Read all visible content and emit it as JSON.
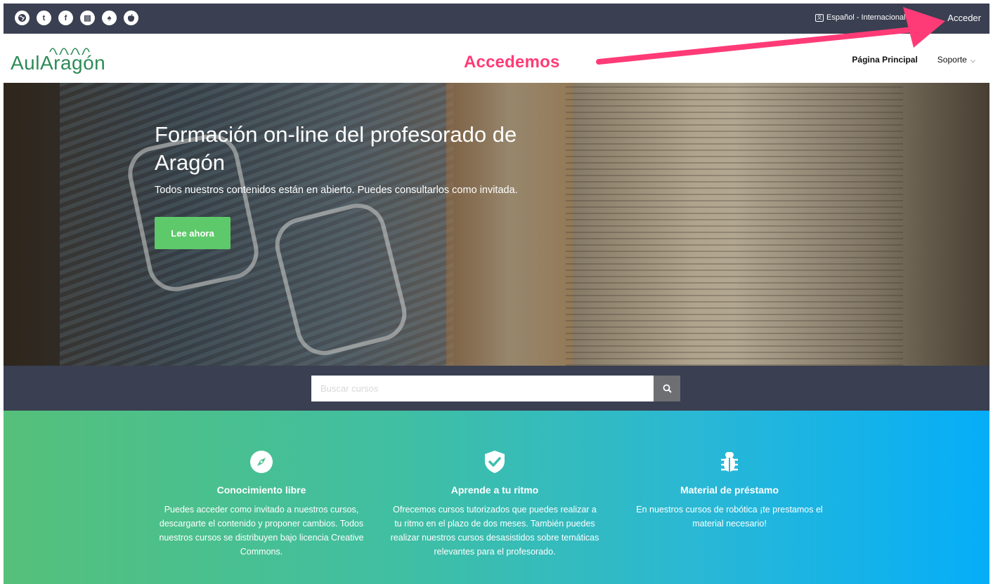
{
  "topbar": {
    "social_icons": [
      {
        "name": "globe-icon",
        "glyph": "●"
      },
      {
        "name": "twitter-icon",
        "glyph": "t"
      },
      {
        "name": "facebook-icon",
        "glyph": "f"
      },
      {
        "name": "blog-icon",
        "glyph": "▤"
      },
      {
        "name": "android-icon",
        "glyph": "♠"
      },
      {
        "name": "apple-icon",
        "glyph": "●"
      }
    ],
    "language": "Español - Internacional",
    "login": "Acceder"
  },
  "header": {
    "logo": "AulAragón",
    "nav": [
      {
        "label": "Página Principal"
      },
      {
        "label": "Soporte"
      }
    ]
  },
  "annotation": {
    "text": "Accedemos",
    "color": "#ff3b77"
  },
  "hero": {
    "title": "Formación on-line del profesorado de Aragón",
    "subtitle": "Todos nuestros contenidos están en abierto. Puedes consultarlos como invitada.",
    "button": "Lee ahora"
  },
  "search": {
    "placeholder": "Buscar cursos"
  },
  "features": [
    {
      "icon": "compass-icon",
      "title": "Conocimiento libre",
      "text": "Puedes acceder como invitado a nuestros cursos, descargarte el contenido y proponer cambios. Todos nuestros cursos se distribuyen bajo licencia Creative Commons."
    },
    {
      "icon": "shield-check-icon",
      "title": "Aprende a tu ritmo",
      "text": "Ofrecemos cursos tutorizados que puedes realizar a tu ritmo en el plazo de dos meses. También puedes realizar nuestros cursos desasistidos sobre temáticas relevantes para el profesorado."
    },
    {
      "icon": "bug-icon",
      "title": "Material de préstamo",
      "text": "En nuestros cursos de robótica ¡te prestamos el material necesario!"
    }
  ],
  "colors": {
    "topbar": "#3a3f51",
    "cta": "#5ec96a",
    "gradient_start": "#55c07a",
    "gradient_end": "#05aef8"
  }
}
